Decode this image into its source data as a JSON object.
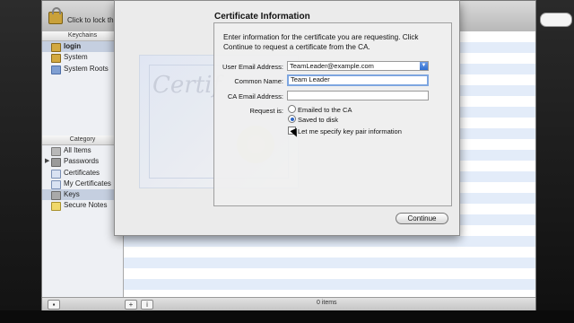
{
  "keychain": {
    "lock_label": "Click to lock the",
    "keychains_header": "Keychains",
    "keychains": [
      {
        "label": "login",
        "icon": "lock-icon",
        "selected": true
      },
      {
        "label": "System",
        "icon": "lock-icon",
        "selected": false
      },
      {
        "label": "System Roots",
        "icon": "folder-icon",
        "selected": false
      }
    ],
    "category_header": "Category",
    "categories": [
      {
        "label": "All Items",
        "icon": "all-items-icon"
      },
      {
        "label": "Passwords",
        "icon": "passwords-icon"
      },
      {
        "label": "Certificates",
        "icon": "certificate-icon"
      },
      {
        "label": "My Certificates",
        "icon": "my-certificates-icon"
      },
      {
        "label": "Keys",
        "icon": "key-icon"
      },
      {
        "label": "Secure Notes",
        "icon": "note-icon"
      }
    ],
    "add_label": "+",
    "info_label": "i",
    "item_count": "0 items"
  },
  "sheet": {
    "title": "Certificate Information",
    "intro": "Enter information for the certificate you are requesting. Click Continue to request a certificate from the CA.",
    "email_label": "User Email Address:",
    "email_value": "TeamLeader@example.com",
    "common_name_label": "Common Name:",
    "common_name_value": "Team Leader",
    "ca_email_label": "CA Email Address:",
    "ca_email_value": "",
    "request_label": "Request is:",
    "option_emailed": "Emailed to the CA",
    "option_saved": "Saved to disk",
    "option_keypair": "Let me specify key pair information",
    "continue_label": "Continue",
    "cert_watermark": "Certif"
  },
  "colors": {
    "selection": "#c5cfe0",
    "stripe": "#e3ecf9",
    "accent": "#2f6fd1"
  }
}
